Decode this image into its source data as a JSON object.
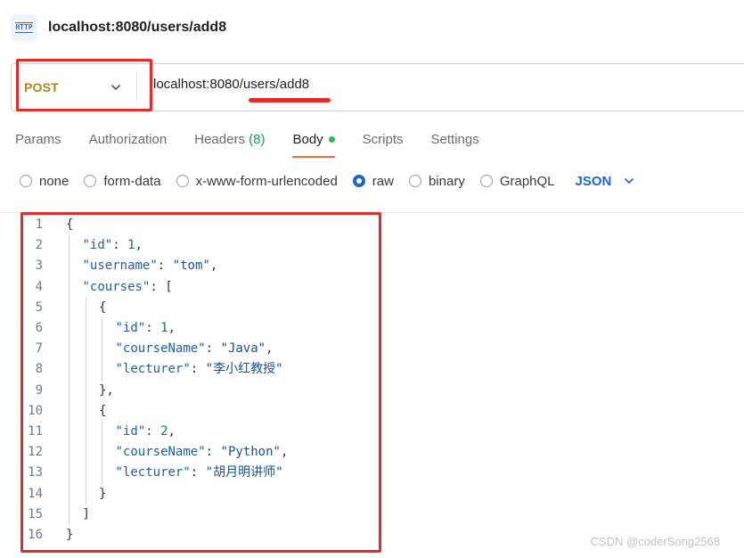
{
  "title": "localhost:8080/users/add8",
  "http_icon_label": "HTTP",
  "request": {
    "method": "POST",
    "url": "localhost:8080/users/add8"
  },
  "tabs": [
    {
      "label": "Params"
    },
    {
      "label": "Authorization"
    },
    {
      "label": "Headers",
      "count": "(8)"
    },
    {
      "label": "Body",
      "active": true
    },
    {
      "label": "Scripts"
    },
    {
      "label": "Settings"
    }
  ],
  "body_types": [
    {
      "label": "none",
      "checked": false
    },
    {
      "label": "form-data",
      "checked": false
    },
    {
      "label": "x-www-form-urlencoded",
      "checked": false
    },
    {
      "label": "raw",
      "checked": true
    },
    {
      "label": "binary",
      "checked": false
    },
    {
      "label": "GraphQL",
      "checked": false
    }
  ],
  "format": "JSON",
  "code_lines": [
    {
      "n": "1",
      "indent": 0,
      "tokens": [
        [
          "p",
          "{"
        ]
      ]
    },
    {
      "n": "2",
      "indent": 1,
      "tokens": [
        [
          "k",
          "\"id\""
        ],
        [
          "p",
          ": "
        ],
        [
          "n",
          "1"
        ],
        [
          "p",
          ","
        ]
      ]
    },
    {
      "n": "3",
      "indent": 1,
      "tokens": [
        [
          "k",
          "\"username\""
        ],
        [
          "p",
          ": "
        ],
        [
          "s",
          "\"tom\""
        ],
        [
          "p",
          ","
        ]
      ]
    },
    {
      "n": "4",
      "indent": 1,
      "tokens": [
        [
          "k",
          "\"courses\""
        ],
        [
          "p",
          ": ["
        ]
      ]
    },
    {
      "n": "5",
      "indent": 2,
      "tokens": [
        [
          "p",
          "{"
        ]
      ]
    },
    {
      "n": "6",
      "indent": 3,
      "tokens": [
        [
          "k",
          "\"id\""
        ],
        [
          "p",
          ": "
        ],
        [
          "n",
          "1"
        ],
        [
          "p",
          ","
        ]
      ]
    },
    {
      "n": "7",
      "indent": 3,
      "tokens": [
        [
          "k",
          "\"courseName\""
        ],
        [
          "p",
          ": "
        ],
        [
          "s",
          "\"Java\""
        ],
        [
          "p",
          ","
        ]
      ]
    },
    {
      "n": "8",
      "indent": 3,
      "tokens": [
        [
          "k",
          "\"lecturer\""
        ],
        [
          "p",
          ": "
        ],
        [
          "s",
          "\"李小红教授\""
        ]
      ]
    },
    {
      "n": "9",
      "indent": 2,
      "tokens": [
        [
          "p",
          "},"
        ]
      ]
    },
    {
      "n": "10",
      "indent": 2,
      "tokens": [
        [
          "p",
          "{"
        ]
      ]
    },
    {
      "n": "11",
      "indent": 3,
      "tokens": [
        [
          "k",
          "\"id\""
        ],
        [
          "p",
          ": "
        ],
        [
          "n",
          "2"
        ],
        [
          "p",
          ","
        ]
      ]
    },
    {
      "n": "12",
      "indent": 3,
      "tokens": [
        [
          "k",
          "\"courseName\""
        ],
        [
          "p",
          ": "
        ],
        [
          "s",
          "\"Python\""
        ],
        [
          "p",
          ","
        ]
      ]
    },
    {
      "n": "13",
      "indent": 3,
      "tokens": [
        [
          "k",
          "\"lecturer\""
        ],
        [
          "p",
          ": "
        ],
        [
          "s",
          "\"胡月明讲师\""
        ]
      ]
    },
    {
      "n": "14",
      "indent": 2,
      "tokens": [
        [
          "p",
          "}"
        ]
      ]
    },
    {
      "n": "15",
      "indent": 1,
      "tokens": [
        [
          "p",
          "]"
        ]
      ]
    },
    {
      "n": "16",
      "indent": 0,
      "tokens": [
        [
          "p",
          "}"
        ]
      ]
    }
  ],
  "watermark": "CSDN @coderSong2568",
  "colors": {
    "method": "#a8861b",
    "accent_blue": "#2266cc",
    "highlight_red": "#e52a2a",
    "tab_underline": "#f26b3a",
    "status_green": "#2eb85c"
  }
}
